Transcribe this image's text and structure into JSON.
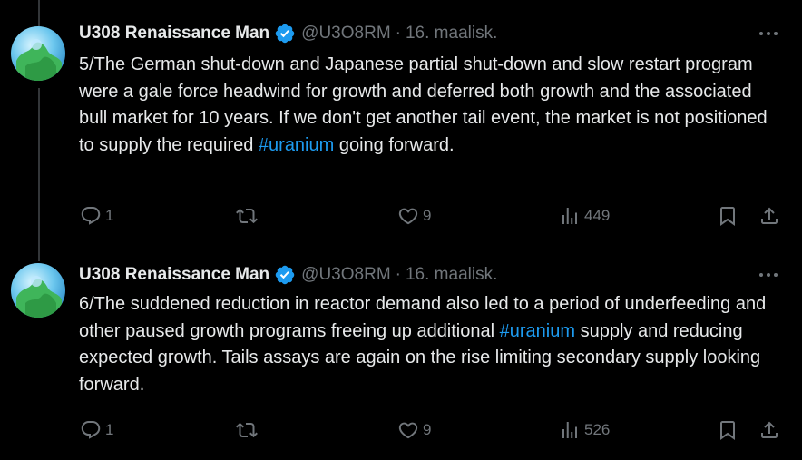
{
  "colors": {
    "background": "#000000",
    "text": "#e7e9ea",
    "muted": "#71767b",
    "link": "#1d9bf0",
    "verified": "#1d9bf0",
    "divider": "#333639"
  },
  "tweets": [
    {
      "author_name": "U308 Renaissance Man",
      "handle": "@U3O8RM",
      "separator": "·",
      "date": "16. maalisk.",
      "text_before": "5/The German shut-down and Japanese partial shut-down and slow restart program were a gale force headwind for growth and deferred both growth and the associated bull market for 10 years. If we don't get another tail event, the market is not positioned to supply the required ",
      "hashtag": "#uranium",
      "text_after": " going forward.",
      "replies": "1",
      "retweets": "",
      "likes": "9",
      "views": "449",
      "icons": [
        "verified-badge-icon",
        "more-icon",
        "reply-icon",
        "retweet-icon",
        "like-icon",
        "views-icon",
        "bookmark-icon",
        "share-icon"
      ]
    },
    {
      "author_name": "U308 Renaissance Man",
      "handle": "@U3O8RM",
      "separator": "·",
      "date": "16. maalisk.",
      "text_before": "6/The suddened reduction in reactor demand also led to a period of underfeeding and other paused growth programs freeing up additional ",
      "hashtag": "#uranium",
      "text_after": " supply and reducing expected growth. Tails assays are again on the rise limiting secondary supply looking  forward.",
      "replies": "1",
      "retweets": "",
      "likes": "9",
      "views": "526",
      "icons": [
        "verified-badge-icon",
        "more-icon",
        "reply-icon",
        "retweet-icon",
        "like-icon",
        "views-icon",
        "bookmark-icon",
        "share-icon"
      ]
    }
  ]
}
